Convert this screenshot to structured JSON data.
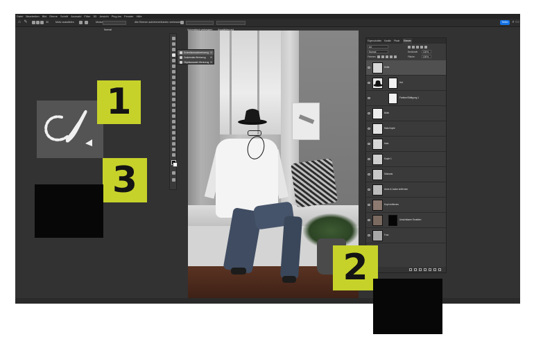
{
  "menu": {
    "items": [
      "Datei",
      "Bearbeiten",
      "Bild",
      "Ebene",
      "Schrift",
      "Auswahl",
      "Filter",
      "3D",
      "Ansicht",
      "Plug-ins",
      "Fenster",
      "Hilfe"
    ]
  },
  "options_bar": {
    "quick_select_label": "Motiv auswählen",
    "select_all_layers_label": "Alle Ebenen aufnehmen",
    "fill_label": "Kanten verbessern",
    "mode_label": "Modus",
    "mode_value": "Normal",
    "auto_enhance_label": "Automatisch verbessern",
    "refine_label": "Auswählen und maskieren ...",
    "share_label": "Teilen"
  },
  "tool_flyout": {
    "items": [
      {
        "label": "Schnellauswahlwerkzeug",
        "key": "W",
        "selected": true
      },
      {
        "label": "Zauberstab-Werkzeug",
        "key": "W",
        "selected": false
      },
      {
        "label": "Objektauswahl-Werkzeug",
        "key": "W",
        "selected": false
      }
    ]
  },
  "panel": {
    "tabs": [
      "Eigenschaften",
      "Kanäle",
      "Pfade",
      "Ebenen"
    ],
    "active_tab": "Ebenen",
    "kind_label": "Art",
    "blend_mode": "Normal",
    "opacity_label": "Deckkraft:",
    "opacity_value": "100%",
    "lock_label": "Fixieren:",
    "fill_label": "Fläche:",
    "fill_value": "100%",
    "layers": [
      {
        "name": "Kette",
        "selected": true,
        "has_mask": false
      },
      {
        "name": "Hut",
        "selected": false,
        "has_mask": true
      },
      {
        "name": "Farbton/Sättigung 1",
        "selected": false,
        "has_mask": true
      },
      {
        "name": "Brille",
        "selected": false,
        "has_mask": false
      },
      {
        "name": "Hals-Kopie",
        "selected": false,
        "has_mask": false
      },
      {
        "name": "Hals",
        "selected": false,
        "has_mask": false
      },
      {
        "name": "Kopie 1",
        "selected": false,
        "has_mask": false
      },
      {
        "name": "Sitzbank",
        "selected": false,
        "has_mask": false
      },
      {
        "name": "Arme & Jacke entfernen",
        "selected": false,
        "has_mask": false
      },
      {
        "name": "Kopf entfernen",
        "selected": false,
        "has_mask": false
      },
      {
        "name": "Unsichtbarer Erstellen",
        "selected": false,
        "has_mask": true
      },
      {
        "name": "Foto",
        "selected": false,
        "has_mask": false
      }
    ]
  },
  "markers": {
    "one": "1",
    "two": "2",
    "three": "3"
  },
  "colors": {
    "marker": "#c6d22a",
    "app_background": "#323232",
    "panel": "#3a3a3a",
    "share": "#1473e6"
  },
  "icons": {
    "zoom_tile": "quick-selection-brush-icon",
    "tools": [
      "move-icon",
      "marquee-icon",
      "lasso-icon",
      "quick-selection-icon",
      "crop-icon",
      "eyedropper-icon",
      "healing-icon",
      "brush-icon",
      "stamp-icon",
      "history-brush-icon",
      "eraser-icon",
      "gradient-icon",
      "blur-icon",
      "dodge-icon",
      "pen-icon",
      "type-icon",
      "path-select-icon",
      "shape-icon",
      "hand-icon",
      "zoom-icon"
    ]
  }
}
